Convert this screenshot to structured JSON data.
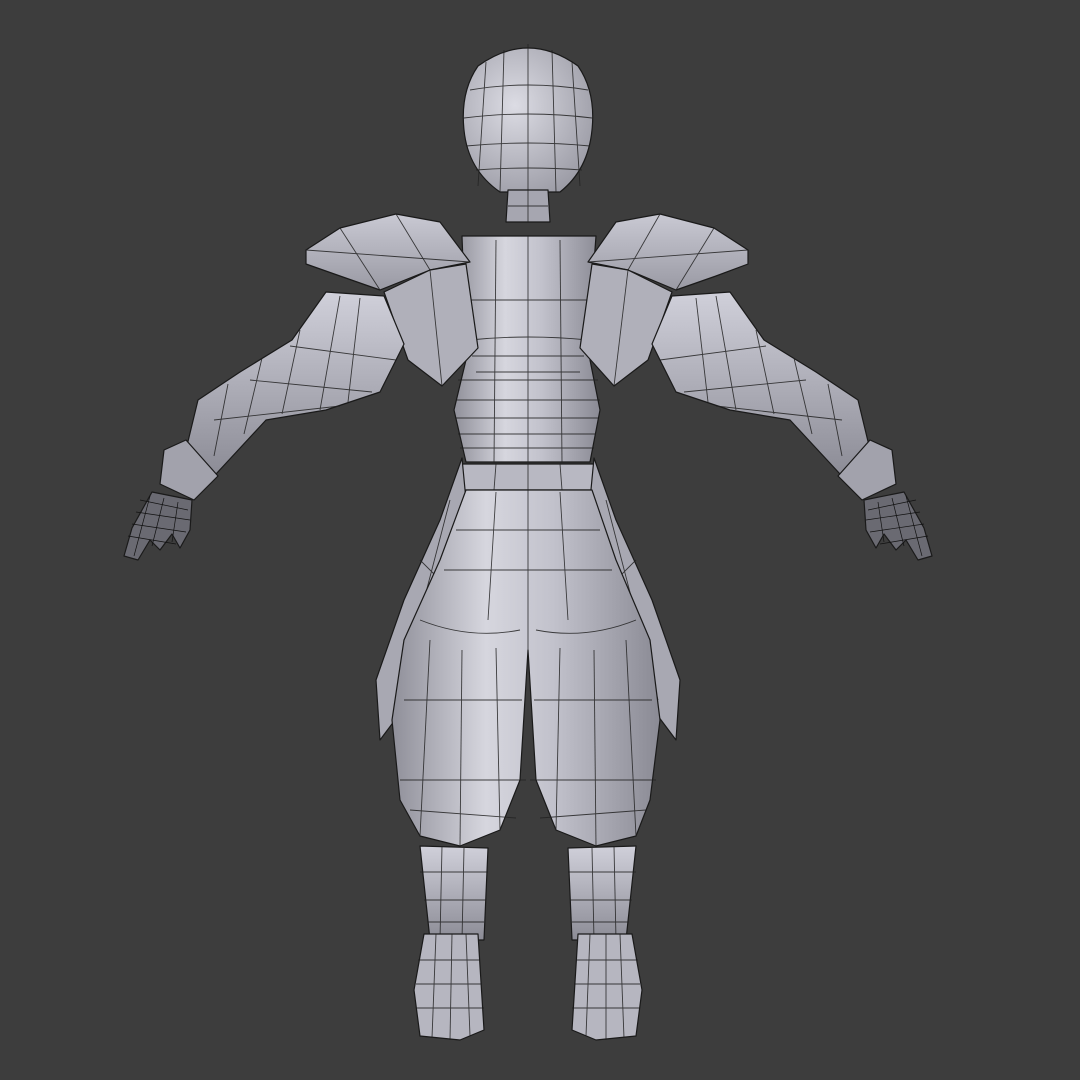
{
  "viewport": {
    "background": "#3d3d3d",
    "shading": "solid",
    "overlay": "wireframe"
  },
  "model": {
    "view": "back",
    "pose": "A-pose",
    "base_color": "#b4b4bc",
    "highlight_color": "#e6e6f0",
    "shadow_color": "#7e7e88",
    "edge_color": "#1a1a1a"
  }
}
